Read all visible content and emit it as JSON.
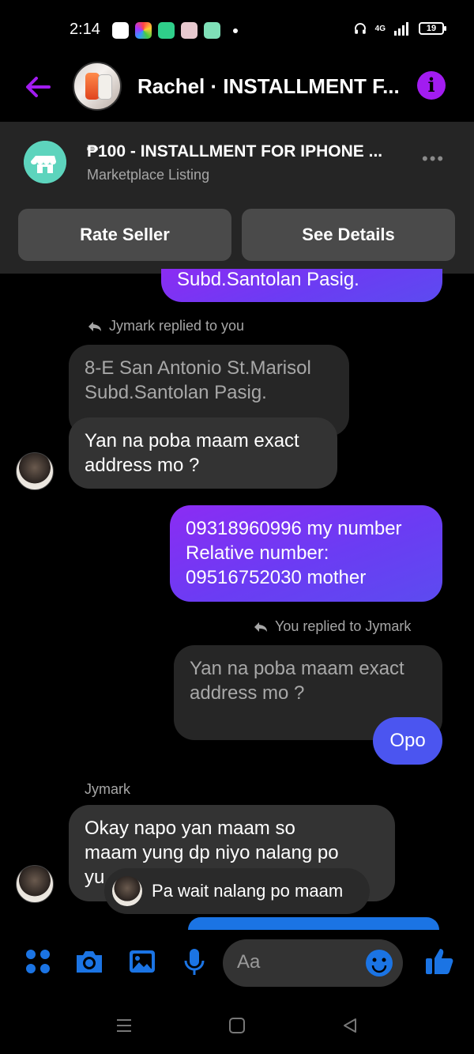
{
  "status_bar": {
    "time": "2:14",
    "network": "4G",
    "battery": "19"
  },
  "header": {
    "title": "Rachel · INSTALLMENT F...",
    "info_icon": "info-icon",
    "back_icon": "back-arrow-icon"
  },
  "listing": {
    "title": "₱100 - INSTALLMENT FOR IPHONE ...",
    "subtitle": "Marketplace Listing",
    "rate_button": "Rate Seller",
    "details_button": "See Details"
  },
  "messages": {
    "top_partial": "Subd.Santolan Pasig.",
    "reply_note_1": "Jymark replied to you",
    "quoted_1_line1": "8-E San Antonio St.Marisol",
    "quoted_1_line2": "Subd.Santolan Pasig.",
    "msg_1_line1": "Yan na poba maam exact",
    "msg_1_line2": "address mo ?",
    "msg_2_line1": "09318960996 my number",
    "msg_2_line2": "Relative number:",
    "msg_2_line3": "09516752030 mother",
    "reply_note_2": "You replied to Jymark",
    "quoted_2_line1": "Yan na poba maam exact",
    "quoted_2_line2": "address mo ?",
    "msg_3": "Opo",
    "sender": "Jymark",
    "msg_4_line1": "Okay napo yan maam so",
    "msg_4_line2": "maam yung dp niyo nalang po",
    "msg_4_line3": "yu"
  },
  "toast": {
    "text": "Pa wait nalang po maam"
  },
  "composer": {
    "placeholder": "Aa"
  },
  "colors": {
    "accent_purple": "#a21cf0",
    "messenger_blue": "#1b74e4",
    "bubble_gray": "#2c2c2c"
  }
}
